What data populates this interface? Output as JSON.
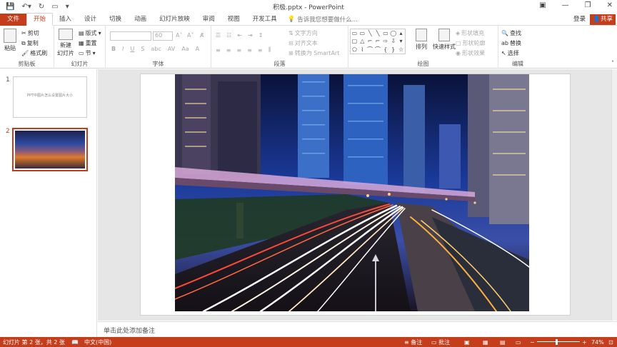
{
  "titlebar": {
    "doc_title": "积极.pptx - PowerPoint",
    "quick_access": [
      "save-icon",
      "undo-icon",
      "redo-icon",
      "presentation-icon",
      "customize-icon"
    ],
    "window_controls": [
      "ribbon-display",
      "minimize",
      "restore",
      "close"
    ]
  },
  "tabs": {
    "file": "文件",
    "items": [
      "开始",
      "插入",
      "设计",
      "切换",
      "动画",
      "幻灯片放映",
      "审阅",
      "视图",
      "开发工具"
    ],
    "active": "开始",
    "tell_me": "告诉我您想要做什么...",
    "login": "登录",
    "share": "共享"
  },
  "ribbon": {
    "clipboard": {
      "label": "剪贴板",
      "paste": "粘贴",
      "cut": "剪切",
      "copy": "复制",
      "format_painter": "格式刷"
    },
    "slides": {
      "label": "幻灯片",
      "new_slide": "新建\n幻灯片",
      "layout": "版式",
      "reset": "重置",
      "section": "节"
    },
    "font": {
      "label": "字体",
      "font_size": "60"
    },
    "paragraph": {
      "label": "段落",
      "text_direction": "文字方向",
      "align_text": "对齐文本",
      "convert_smartart": "转换为 SmartArt"
    },
    "drawing": {
      "label": "绘图",
      "arrange": "排列",
      "quick_styles": "快速样式",
      "shape_fill": "形状填充",
      "shape_outline": "形状轮廓",
      "shape_effects": "形状效果"
    },
    "editing": {
      "label": "编辑",
      "find": "查找",
      "replace": "替换",
      "select": "选择"
    }
  },
  "slides_panel": [
    {
      "num": "1",
      "text": "PPT中图片怎么设置图片大小"
    },
    {
      "num": "2",
      "text": ""
    }
  ],
  "notes_placeholder": "单击此处添加备注",
  "status": {
    "slide_info": "幻灯片 第 2 张，共 2 张",
    "language": "中文(中国)",
    "notes": "备注",
    "comments": "批注",
    "zoom": "74%"
  }
}
